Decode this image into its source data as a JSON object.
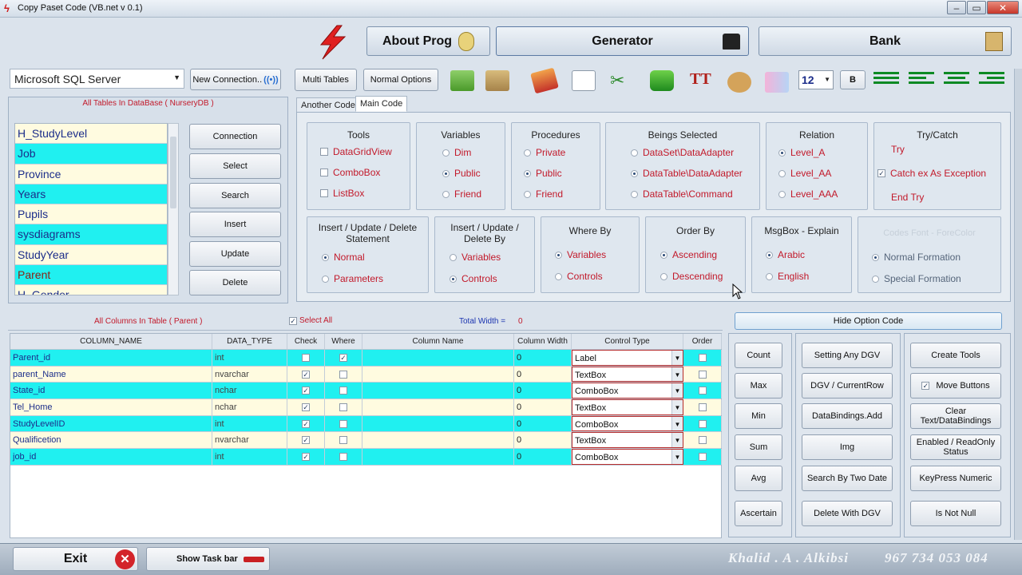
{
  "window": {
    "title": "Copy Paset Code (VB.net  v 0.1)"
  },
  "topnav": {
    "about": "About Prog",
    "generator": "Generator",
    "bank": "Bank"
  },
  "db": {
    "provider": "Microsoft SQL Server",
    "new_connection": "New Connection..",
    "tables_caption": "All Tables In DataBase ( NurseryDB )"
  },
  "toolbar": {
    "multi_tables": "Multi Tables",
    "normal_options": "Normal Options",
    "font_size": "12",
    "bold": "B"
  },
  "tables": [
    "H_StudyLevel",
    "Job",
    "Province",
    "Years",
    "Pupils",
    "sysdiagrams",
    "StudyYear",
    "Parent",
    "H_Gender"
  ],
  "actions": [
    "Connection",
    "Select",
    "Search",
    "Insert",
    "Update",
    "Delete"
  ],
  "tabs": {
    "another": "Another Code",
    "main": "Main Code"
  },
  "groups": {
    "tools": {
      "title": "Tools",
      "items": [
        {
          "label": "DataGridView",
          "checked": false
        },
        {
          "label": "ComboBox",
          "checked": false
        },
        {
          "label": "ListBox",
          "checked": false
        }
      ]
    },
    "variables": {
      "title": "Variables",
      "items": [
        "Dim",
        "Public",
        "Friend"
      ],
      "selected": 1
    },
    "procedures": {
      "title": "Procedures",
      "items": [
        "Private",
        "Public",
        "Friend"
      ],
      "selected": 1
    },
    "beings": {
      "title": "Beings Selected",
      "items": [
        "DataSet\\DataAdapter",
        "DataTable\\DataAdapter",
        "DataTable\\Command"
      ],
      "selected": 1
    },
    "relation": {
      "title": "Relation",
      "items": [
        "Level_A",
        "Level_AA",
        "Level_AAA"
      ],
      "selected": 0
    },
    "trycatch": {
      "title": "Try/Catch",
      "try": "Try",
      "catch": "Catch ex As Exception",
      "catch_checked": true,
      "end": "End Try"
    },
    "statement": {
      "title": "Insert / Update / Delete Statement",
      "items": [
        "Normal",
        "Parameters"
      ],
      "selected": 0
    },
    "deleteby": {
      "title": "Insert / Update / Delete By",
      "items": [
        "Variables",
        "Controls"
      ],
      "selected": 1
    },
    "whereby": {
      "title": "Where By",
      "items": [
        "Variables",
        "Controls"
      ],
      "selected": 0
    },
    "orderby": {
      "title": "Order By",
      "items": [
        "Ascending",
        "Descending"
      ],
      "selected": 0
    },
    "msgbox": {
      "title": "MsgBox - Explain",
      "items": [
        "Arabic",
        "English"
      ],
      "selected": 0
    },
    "codesfont": {
      "title": "Codes Font - ForeColor",
      "items": [
        "Normal Formation",
        "Special Formation"
      ],
      "selected": 0
    }
  },
  "columns_bar": {
    "caption": "All Columns In Table ( Parent )",
    "select_all": "Select All",
    "total_width_label": "Total Width =",
    "total_width": "0",
    "hide_option": "Hide Option Code"
  },
  "grid": {
    "headers": [
      "COLUMN_NAME",
      "DATA_TYPE",
      "Check",
      "Where",
      "Column Name",
      "Column Width",
      "Control Type",
      "Order"
    ],
    "rows": [
      {
        "name": "Parent_id",
        "type": "int",
        "check": false,
        "where": true,
        "colname": "",
        "width": "0",
        "control": "Label",
        "order": false
      },
      {
        "name": "parent_Name",
        "type": "nvarchar",
        "check": true,
        "where": false,
        "colname": "",
        "width": "0",
        "control": "TextBox",
        "order": false
      },
      {
        "name": "State_id",
        "type": "nchar",
        "check": true,
        "where": false,
        "colname": "",
        "width": "0",
        "control": "ComboBox",
        "order": false
      },
      {
        "name": "Tel_Home",
        "type": "nchar",
        "check": true,
        "where": false,
        "colname": "",
        "width": "0",
        "control": "TextBox",
        "order": false
      },
      {
        "name": "StudyLevelID",
        "type": "int",
        "check": true,
        "where": false,
        "colname": "",
        "width": "0",
        "control": "ComboBox",
        "order": false
      },
      {
        "name": "Qualificetion",
        "type": "nvarchar",
        "check": true,
        "where": false,
        "colname": "",
        "width": "0",
        "control": "TextBox",
        "order": false
      },
      {
        "name": "job_id",
        "type": "int",
        "check": true,
        "where": false,
        "colname": "",
        "width": "0",
        "control": "ComboBox",
        "order": false
      }
    ]
  },
  "agg_buttons": [
    "Count",
    "Max",
    "Min",
    "Sum",
    "Avg",
    "Ascertain"
  ],
  "mid_buttons": [
    "Setting Any DGV",
    "DGV / CurrentRow",
    "DataBindings.Add",
    "Img",
    "Search By Two Date",
    "Delete With DGV"
  ],
  "right_buttons": [
    "Create Tools",
    "Move Buttons",
    "Clear Text/DataBindings",
    "Enabled / ReadOnly Status",
    "KeyPress Numeric",
    "Is Not Null"
  ],
  "footer": {
    "exit": "Exit",
    "taskbar": "Show Task bar",
    "author": "Khalid . A . Alkibsi",
    "phone": "967 734 053 084"
  }
}
